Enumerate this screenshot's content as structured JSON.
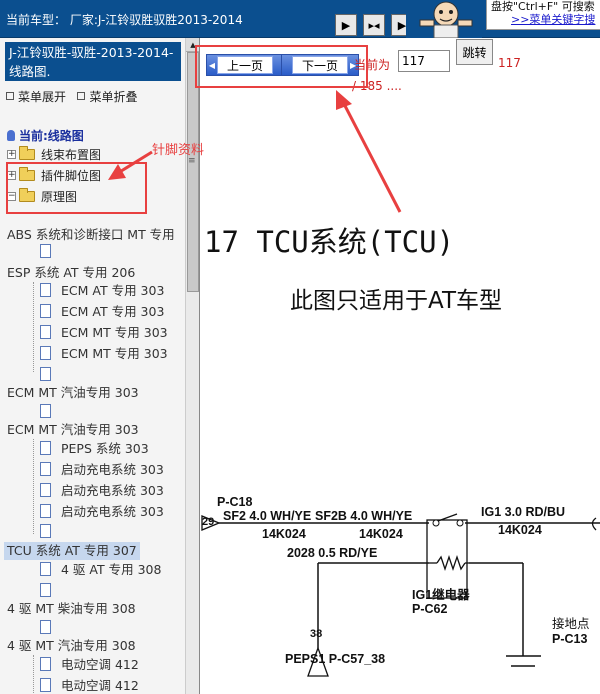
{
  "header": {
    "car_label": "当前车型： 厂家:J-江铃驭胜驭胜2013-2014",
    "hint_text": "盘按\"Ctrl+F\" 可搜索",
    "hint_link": ">>菜单关键字搜"
  },
  "left_panel": {
    "title": "J-江铃驭胜-驭胜-2013-2014- 线路图.",
    "menu_expand": "菜单展开",
    "menu_collapse": "菜单折叠",
    "current_node": "当前:线路图",
    "folders": [
      "线束布置图",
      "插件脚位图",
      "原理图"
    ],
    "tree": [
      "ABS 系统和诊断接口 MT 专用",
      "",
      "ESP 系统 AT 专用 206",
      "ECM AT 专用 303",
      "ECM AT 专用 303",
      "ECM MT 专用 303",
      "ECM MT 专用 303",
      "",
      "ECM MT 汽油专用 303",
      "",
      "ECM MT 汽油专用 303",
      "PEPS 系统 303",
      "启动充电系统 303",
      "启动充电系统 303",
      "启动充电系统 303",
      "",
      "TCU 系统 AT 专用 307",
      "4 驱 AT 专用 308",
      "",
      "4 驱 MT 柴油专用 308",
      "",
      "4 驱 MT 汽油专用 308",
      "电动空调 412",
      "电动空调 412"
    ]
  },
  "pager": {
    "prev_label": "上一页",
    "next_label": "下一页",
    "prefix": "当前为",
    "input_value": "117",
    "jump_label": "跳转",
    "current": "117",
    "total": "/ 185 ...."
  },
  "annotation": {
    "pin_label": "针脚资料"
  },
  "content": {
    "heading": "17 TCU系统(TCU)",
    "subheading": "此图只适用于AT车型",
    "diagram": {
      "connector": "P-C18",
      "pin": "29",
      "wire1": "SF2 4.0 WH/YE",
      "wire2": "SF2B 4.0 WH/YE",
      "wire3": "IG1 3.0 RD/BU",
      "harness1": "14K024",
      "harness2": "14K024",
      "harness3": "14K024",
      "wire4": "2028 0.5 RD/YE",
      "relay": "IG1继电器",
      "relay_code": "P-C62",
      "ground": "接地点",
      "ground_code": "P-C13",
      "pin2": "38",
      "peps": "PEPS1 P-C57_38"
    }
  },
  "colors": {
    "header_bg": "#0b4f8f",
    "annotation_red": "#e84040",
    "page_red": "#cc2222"
  }
}
